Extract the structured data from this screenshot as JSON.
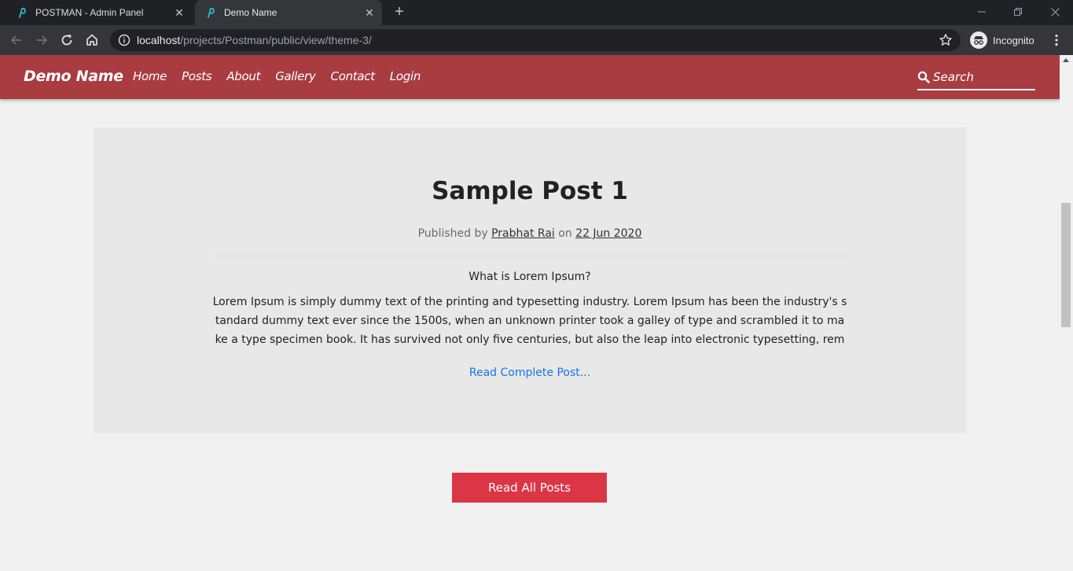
{
  "browser": {
    "tabs": [
      {
        "title": "POSTMAN - Admin Panel",
        "active": false
      },
      {
        "title": "Demo Name",
        "active": true
      }
    ],
    "new_tab_label": "+",
    "close_glyph": "✕",
    "url_host": "localhost",
    "url_path": "/projects/Postman/public/view/theme-3/",
    "profile_label": "Incognito",
    "icons": [
      "back-icon",
      "forward-icon",
      "reload-icon",
      "home-icon",
      "info-icon",
      "star-icon",
      "incognito-icon",
      "kebab-menu-icon",
      "minimize-icon",
      "restore-icon",
      "close-icon"
    ]
  },
  "site": {
    "brand": "Demo Name",
    "nav": [
      "Home",
      "Posts",
      "About",
      "Gallery",
      "Contact",
      "Login"
    ],
    "search_placeholder": "Search",
    "colors": {
      "header": "#a83c40",
      "button": "#dc3545",
      "link": "#1a73e8"
    }
  },
  "post": {
    "title": "Sample Post 1",
    "published_by": "Published by",
    "author": "Prabhat Rai",
    "on": "on",
    "date": "22 Jun 2020",
    "subheading": "What is Lorem Ipsum?",
    "excerpt": "Lorem Ipsum is simply dummy text of the printing and typesetting industry. Lorem Ipsum has been the industry's standard dummy text ever since the 1500s, when an unknown printer took a galley of type and scrambled it to make a type specimen book. It has survived not only five centuries, but also the leap into electronic typesetting, remai",
    "read_more": "Read Complete Post..."
  },
  "read_all_label": "Read All Posts"
}
